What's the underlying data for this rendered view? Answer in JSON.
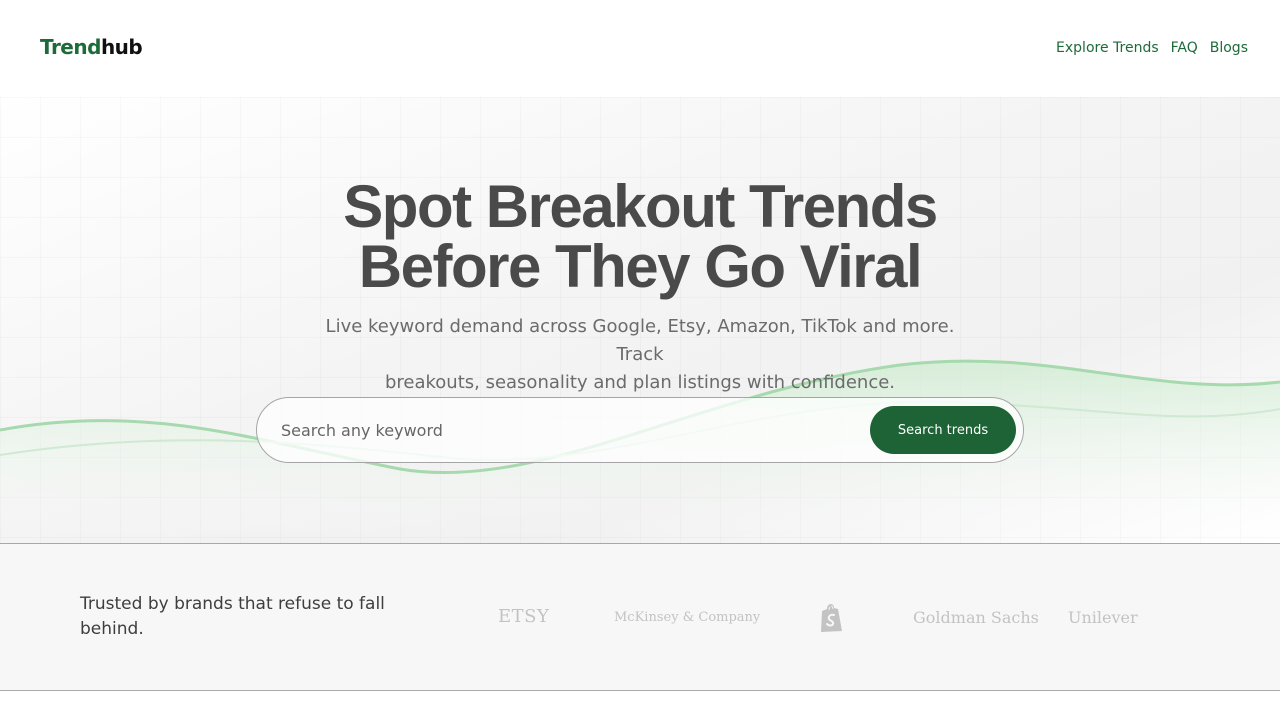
{
  "header": {
    "logo_part1": "Trend",
    "logo_part2": "hub",
    "nav": [
      {
        "label": "Explore Trends"
      },
      {
        "label": "FAQ"
      },
      {
        "label": "Blogs"
      }
    ]
  },
  "hero": {
    "title_line1": "Spot Breakout Trends",
    "title_line2": "Before They Go Viral",
    "subtitle_line1": "Live keyword demand across Google, Etsy, Amazon, TikTok and more. Track",
    "subtitle_line2": "breakouts, seasonality and plan listings with confidence.",
    "search_placeholder": "Search any keyword",
    "search_button": "Search trends"
  },
  "trusted": {
    "text": "Trusted by brands that refuse to fall behind.",
    "brands": [
      "ETSY",
      "McKinsey & Company",
      "shopify-icon",
      "Goldman Sachs",
      "Unilever"
    ]
  },
  "colors": {
    "brand_green": "#1d6335",
    "heading_gray": "#4a4a4a",
    "wave_green": "#a7d9ae"
  }
}
